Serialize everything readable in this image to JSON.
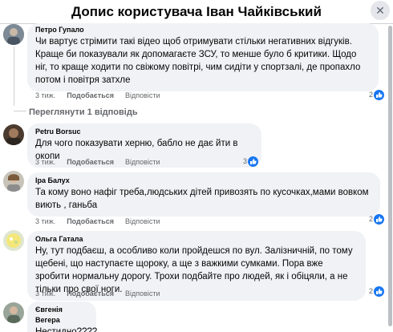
{
  "header": {
    "title": "Допис користувача Іван Чайківський",
    "close_icon": "close-icon"
  },
  "actions_labels": {
    "like": "Подобається",
    "reply": "Відповісти"
  },
  "comments": [
    {
      "author": "Петро Гупало",
      "text": "Чи вартує стрімити такі відео щоб отримувати стільки негативних відгуків. Краще би показували як допомагаєте ЗСУ, то менше було б критики. Щодо ніг, то краще ходити по свіжому повітрі, чим сидіти у спортзалі, де пропахло потом і повітря затхле",
      "time": "3 тиж.",
      "reactions": "2",
      "replies_link": "Переглянути 1 відповідь"
    },
    {
      "author": "Petru Borsuc",
      "text": "Для чого показувати херню, бабло не дає йти в окопи",
      "time": "3 тиж.",
      "reactions": "3"
    },
    {
      "author": "Іра Балух",
      "text": "Та кому воно нафіг треба,людських дітей привозять по кусочках,мами вовком виють , ганьба",
      "time": "3 тиж.",
      "reactions": "2"
    },
    {
      "author": "Ольга Гатала",
      "text": "Ну, тут подбаєш, а особливо коли пройдешся по вул. Залізничній, по тому щебені, що наступаєте щороку, а ще з важкими сумками. Пора вже зробити нормальну дорогу. Трохи подбайте про людей, як і обіцяли, а не тільки про свої ноги.",
      "time": "3 тиж.",
      "reactions": "2"
    },
    {
      "author": "Євгенія Вегера",
      "text": "Нестидно????"
    }
  ],
  "colors": {
    "bubble": "#f0f2f5",
    "like_blue": "#1877f2",
    "meta_gray": "#65676b"
  }
}
